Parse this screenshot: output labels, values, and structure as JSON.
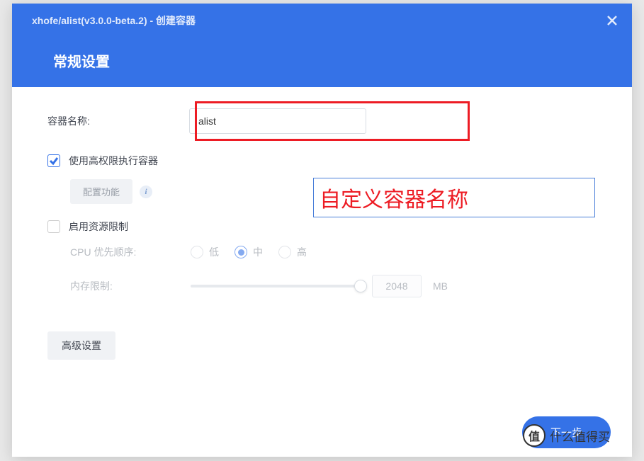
{
  "header": {
    "breadcrumb": "xhofe/alist(v3.0.0-beta.2) - 创建容器",
    "title": "常规设置"
  },
  "form": {
    "container_name_label": "容器名称:",
    "container_name_value": "alist",
    "high_privilege_label": "使用高权限执行容器",
    "config_button": "配置功能",
    "resource_limit_label": "启用资源限制",
    "cpu_priority_label": "CPU 优先顺序:",
    "cpu_options": {
      "low": "低",
      "mid": "中",
      "high": "高"
    },
    "memory_limit_label": "内存限制:",
    "memory_value": "2048",
    "memory_unit": "MB",
    "advanced_button": "高级设置"
  },
  "annotation": {
    "text": "自定义容器名称"
  },
  "footer": {
    "next_button": "下一步"
  },
  "watermark": {
    "circle": "值",
    "text": "什么值得买"
  }
}
